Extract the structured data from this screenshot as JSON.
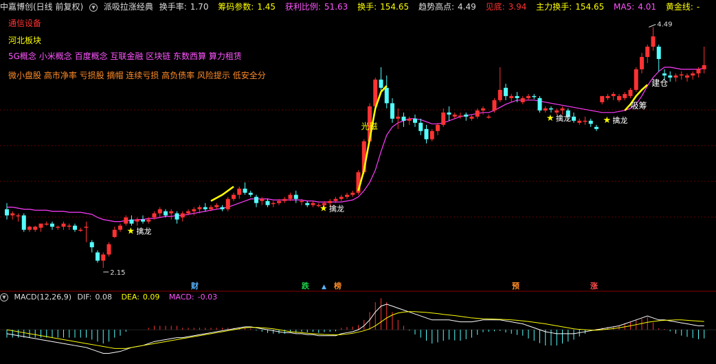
{
  "header": {
    "stock_name": "中嘉博创(日线 前复权)",
    "indicator_name": "派吸拉涨经典",
    "turnover_rate_label": "换手率:",
    "turnover_rate_value": "1.70",
    "chip_param_label": "筹码参数:",
    "chip_param_value": "1.45",
    "profit_ratio_label": "获利比例:",
    "profit_ratio_value": "51.63",
    "turnover_label": "换手:",
    "turnover_value": "154.65",
    "trend_high_label": "趋势高点:",
    "trend_high_value": "4.49",
    "bottom_label": "见底:",
    "bottom_value": "3.94",
    "main_turnover_label": "主力换手:",
    "main_turnover_value": "154.65",
    "ma5_label": "MA5:",
    "ma5_value": "4.01",
    "golden_line_label": "黄金线:",
    "golden_line_value": "-"
  },
  "tags": {
    "industry": "通信设备",
    "region": "河北板块",
    "concepts": "5G概念 小米概念 百度概念 互联金融 区块链 东数西算 算力租赁",
    "styles": "微小盘股 高市净率 亏损股 摘帽 连续亏损 高负债率 风险提示 低安全分"
  },
  "price_annotations": {
    "high_label": "4.49",
    "low_label": "2.15",
    "star_glyph": "★",
    "signal_label": "擒龙",
    "absorb_label": "吸筹",
    "build_label": "建仓",
    "lights_label": "光磁"
  },
  "event_marks": [
    {
      "label": "财",
      "color": "#5ab4ff"
    },
    {
      "label": "跌",
      "color": "#1ed04a"
    },
    {
      "label": "榜",
      "color": "#ff8c28"
    },
    {
      "label": "预",
      "color": "#ff8c28"
    },
    {
      "label": "涨",
      "color": "#ff4a4a"
    }
  ],
  "macd": {
    "title": "MACD(12,26,9)",
    "dif_label": "DIF:",
    "dif_value": "0.08",
    "dea_label": "DEA:",
    "dea_value": "0.09",
    "macd_label": "MACD:",
    "macd_value": "-0.03"
  },
  "colors": {
    "background": "#000000",
    "up": "#ff3232",
    "down": "#54ffff",
    "ma_line": "#ff3cff",
    "signal_line": "#ffff00",
    "dif_line": "#ffffff",
    "dea_line": "#ffff00",
    "grid": "#8b0000",
    "label_cyan": "#00ffff",
    "label_yellow": "#ffff00",
    "label_magenta": "#ff55ff",
    "label_red": "#ff3232"
  },
  "chart_data": {
    "type": "candlestick",
    "price_ylim": [
      2.05,
      4.62
    ],
    "candles": [
      [
        2.72,
        2.78,
        2.66,
        2.62
      ],
      [
        2.66,
        2.7,
        2.68,
        2.62
      ],
      [
        2.66,
        2.68,
        2.66,
        2.6
      ],
      [
        2.66,
        2.68,
        2.52,
        2.5
      ],
      [
        2.52,
        2.56,
        2.55,
        2.5
      ],
      [
        2.52,
        2.56,
        2.55,
        2.5
      ],
      [
        2.54,
        2.58,
        2.58,
        2.5
      ],
      [
        2.58,
        2.6,
        2.58,
        2.56
      ],
      [
        2.58,
        2.6,
        2.55,
        2.52
      ],
      [
        2.55,
        2.56,
        2.55,
        2.52
      ],
      [
        2.55,
        2.6,
        2.58,
        2.52
      ],
      [
        2.55,
        2.58,
        2.56,
        2.52
      ],
      [
        2.56,
        2.58,
        2.52,
        2.5
      ],
      [
        2.52,
        2.54,
        2.52,
        2.5
      ],
      [
        2.55,
        2.6,
        2.55,
        2.4
      ],
      [
        2.4,
        2.42,
        2.35,
        2.3
      ],
      [
        2.3,
        2.32,
        2.22,
        2.2
      ],
      [
        2.22,
        2.3,
        2.28,
        2.15
      ],
      [
        2.28,
        2.4,
        2.38,
        2.26
      ],
      [
        2.45,
        2.55,
        2.52,
        2.44
      ],
      [
        2.52,
        2.58,
        2.56,
        2.5
      ],
      [
        2.58,
        2.66,
        2.64,
        2.56
      ],
      [
        2.62,
        2.66,
        2.58,
        2.56
      ],
      [
        2.6,
        2.64,
        2.62,
        2.56
      ],
      [
        2.62,
        2.66,
        2.6,
        2.58
      ],
      [
        2.6,
        2.64,
        2.62,
        2.58
      ],
      [
        2.64,
        2.7,
        2.68,
        2.62
      ],
      [
        2.68,
        2.74,
        2.72,
        2.64
      ],
      [
        2.7,
        2.72,
        2.66,
        2.64
      ],
      [
        2.68,
        2.72,
        2.7,
        2.62
      ],
      [
        2.68,
        2.7,
        2.62,
        2.58
      ],
      [
        2.64,
        2.7,
        2.68,
        2.6
      ],
      [
        2.68,
        2.72,
        2.7,
        2.66
      ],
      [
        2.7,
        2.74,
        2.72,
        2.66
      ],
      [
        2.72,
        2.76,
        2.74,
        2.68
      ],
      [
        2.74,
        2.78,
        2.72,
        2.7
      ],
      [
        2.72,
        2.76,
        2.74,
        2.7
      ],
      [
        2.74,
        2.78,
        2.76,
        2.72
      ],
      [
        2.74,
        2.76,
        2.72,
        2.7
      ],
      [
        2.72,
        2.84,
        2.82,
        2.7
      ],
      [
        2.82,
        2.88,
        2.86,
        2.8
      ],
      [
        2.86,
        2.94,
        2.92,
        2.82
      ],
      [
        2.92,
        2.98,
        2.88,
        2.86
      ],
      [
        2.88,
        2.9,
        2.86,
        2.84
      ],
      [
        2.84,
        2.86,
        2.78,
        2.74
      ],
      [
        2.8,
        2.84,
        2.82,
        2.76
      ],
      [
        2.8,
        2.82,
        2.76,
        2.74
      ],
      [
        2.78,
        2.8,
        2.78,
        2.74
      ],
      [
        2.78,
        2.82,
        2.8,
        2.76
      ],
      [
        2.8,
        2.84,
        2.82,
        2.78
      ],
      [
        2.82,
        2.88,
        2.86,
        2.8
      ],
      [
        2.86,
        2.9,
        2.82,
        2.78
      ],
      [
        2.8,
        2.82,
        2.8,
        2.76
      ],
      [
        2.78,
        2.8,
        2.76,
        2.74
      ],
      [
        2.76,
        2.8,
        2.78,
        2.74
      ],
      [
        2.76,
        2.78,
        2.76,
        2.74
      ],
      [
        2.76,
        2.8,
        2.78,
        2.74
      ],
      [
        2.78,
        2.82,
        2.8,
        2.74
      ],
      [
        2.8,
        2.84,
        2.82,
        2.78
      ],
      [
        2.82,
        2.86,
        2.84,
        2.8
      ],
      [
        2.84,
        2.88,
        2.86,
        2.82
      ],
      [
        2.86,
        2.9,
        2.88,
        2.84
      ],
      [
        2.88,
        3.1,
        3.08,
        2.86
      ],
      [
        3.08,
        3.4,
        3.38,
        3.06
      ],
      [
        3.38,
        3.75,
        3.72,
        3.36
      ],
      [
        3.72,
        4.0,
        3.98,
        3.7
      ],
      [
        3.98,
        4.1,
        3.9,
        3.84
      ],
      [
        3.9,
        4.02,
        3.75,
        3.7
      ],
      [
        3.75,
        3.8,
        3.6,
        3.56
      ],
      [
        3.6,
        3.7,
        3.62,
        3.5
      ],
      [
        3.62,
        3.66,
        3.58,
        3.52
      ],
      [
        3.58,
        3.62,
        3.6,
        3.54
      ],
      [
        3.6,
        3.64,
        3.56,
        3.52
      ],
      [
        3.56,
        3.6,
        3.48,
        3.44
      ],
      [
        3.5,
        3.54,
        3.4,
        3.36
      ],
      [
        3.4,
        3.5,
        3.48,
        3.38
      ],
      [
        3.48,
        3.56,
        3.54,
        3.44
      ],
      [
        3.54,
        3.7,
        3.66,
        3.52
      ],
      [
        3.66,
        3.72,
        3.64,
        3.58
      ],
      [
        3.62,
        3.66,
        3.64,
        3.6
      ],
      [
        3.62,
        3.66,
        3.63,
        3.6
      ],
      [
        3.64,
        3.66,
        3.62,
        3.58
      ],
      [
        3.6,
        3.64,
        3.62,
        3.58
      ],
      [
        3.62,
        3.7,
        3.68,
        3.6
      ],
      [
        3.68,
        3.72,
        3.7,
        3.64
      ],
      [
        3.62,
        3.64,
        3.62,
        3.6
      ],
      [
        3.68,
        3.8,
        3.78,
        3.66
      ],
      [
        3.78,
        4.1,
        3.88,
        3.76
      ],
      [
        3.9,
        3.94,
        3.82,
        3.78
      ],
      [
        3.8,
        3.84,
        3.82,
        3.76
      ],
      [
        3.82,
        3.86,
        3.8,
        3.76
      ],
      [
        3.76,
        3.82,
        3.8,
        3.74
      ],
      [
        3.8,
        3.84,
        3.82,
        3.78
      ],
      [
        3.82,
        3.84,
        3.81,
        3.79
      ],
      [
        3.8,
        3.82,
        3.68,
        3.66
      ],
      [
        3.68,
        3.72,
        3.7,
        3.66
      ],
      [
        3.7,
        3.72,
        3.69,
        3.66
      ],
      [
        3.66,
        3.7,
        3.68,
        3.64
      ],
      [
        3.68,
        3.72,
        3.7,
        3.64
      ],
      [
        3.68,
        3.7,
        3.62,
        3.6
      ],
      [
        3.62,
        3.66,
        3.58,
        3.56
      ],
      [
        3.56,
        3.6,
        3.58,
        3.54
      ],
      [
        3.58,
        3.62,
        3.58,
        3.54
      ],
      [
        3.58,
        3.6,
        3.55,
        3.52
      ],
      [
        3.52,
        3.54,
        3.5,
        3.48
      ],
      [
        3.76,
        3.8,
        3.82,
        3.74
      ],
      [
        3.8,
        3.84,
        3.82,
        3.78
      ],
      [
        3.82,
        3.86,
        3.84,
        3.78
      ],
      [
        3.78,
        3.84,
        3.82,
        3.76
      ],
      [
        3.8,
        3.86,
        3.84,
        3.78
      ],
      [
        3.82,
        3.9,
        3.88,
        3.8
      ],
      [
        3.88,
        4.1,
        4.08,
        3.86
      ],
      [
        4.08,
        4.24,
        4.2,
        4.04
      ],
      [
        4.2,
        4.32,
        4.3,
        4.14
      ],
      [
        4.3,
        4.49,
        4.4,
        4.26
      ],
      [
        4.3,
        4.32,
        4.18,
        4.06
      ],
      [
        4.04,
        4.08,
        4.02,
        3.98
      ],
      [
        4.02,
        4.06,
        4.0,
        3.96
      ],
      [
        4.0,
        4.04,
        4.02,
        3.96
      ],
      [
        4.02,
        4.06,
        4.03,
        3.98
      ],
      [
        4.0,
        4.04,
        4.02,
        3.96
      ],
      [
        4.02,
        4.06,
        4.04,
        3.98
      ],
      [
        4.04,
        4.1,
        4.08,
        4.0
      ],
      [
        4.08,
        4.3,
        4.12,
        4.04
      ]
    ],
    "ma_line": [
      2.74,
      2.74,
      2.73,
      2.72,
      2.72,
      2.71,
      2.71,
      2.71,
      2.7,
      2.7,
      2.7,
      2.69,
      2.69,
      2.69,
      2.68,
      2.67,
      2.64,
      2.62,
      2.61,
      2.6,
      2.6,
      2.61,
      2.61,
      2.62,
      2.62,
      2.63,
      2.63,
      2.64,
      2.65,
      2.65,
      2.66,
      2.66,
      2.67,
      2.68,
      2.69,
      2.7,
      2.71,
      2.72,
      2.73,
      2.74,
      2.76,
      2.78,
      2.8,
      2.82,
      2.82,
      2.82,
      2.82,
      2.81,
      2.81,
      2.81,
      2.81,
      2.81,
      2.81,
      2.8,
      2.8,
      2.79,
      2.79,
      2.79,
      2.79,
      2.79,
      2.8,
      2.81,
      2.84,
      2.9,
      2.98,
      3.1,
      3.28,
      3.44,
      3.52,
      3.56,
      3.58,
      3.6,
      3.6,
      3.59,
      3.57,
      3.55,
      3.55,
      3.56,
      3.58,
      3.6,
      3.62,
      3.63,
      3.64,
      3.65,
      3.66,
      3.66,
      3.68,
      3.71,
      3.74,
      3.76,
      3.78,
      3.78,
      3.78,
      3.78,
      3.77,
      3.76,
      3.75,
      3.74,
      3.73,
      3.72,
      3.71,
      3.7,
      3.69,
      3.68,
      3.67,
      3.66,
      3.66,
      3.66,
      3.67,
      3.68,
      3.7,
      3.74,
      3.82,
      3.92,
      4.0,
      4.06,
      4.1,
      4.1,
      4.09,
      4.08,
      4.08,
      4.08,
      4.08,
      4.09
    ],
    "signal_segments": [
      {
        "start": 36,
        "values": [
          2.8,
          2.83,
          2.86,
          2.9,
          2.94
        ]
      },
      {
        "start": 62,
        "values": [
          2.9,
          3.1,
          3.4,
          3.7,
          3.86,
          3.92
        ]
      },
      {
        "start": 109,
        "values": [
          3.68,
          3.74,
          3.82,
          3.88,
          3.93
        ]
      }
    ],
    "markers": [
      {
        "type": "star",
        "index": 22,
        "price": 2.56
      },
      {
        "type": "star",
        "index": 56,
        "price": 2.78
      },
      {
        "type": "star",
        "index": 96,
        "price": 3.66
      },
      {
        "type": "star",
        "index": 106,
        "price": 3.64
      },
      {
        "type": "label_high",
        "index": 113,
        "price": 4.49
      },
      {
        "type": "label_low",
        "index": 17,
        "price": 2.15
      }
    ],
    "macd_ylim": [
      -0.16,
      0.14
    ],
    "dif": [
      -0.02,
      -0.025,
      -0.03,
      -0.035,
      -0.04,
      -0.045,
      -0.05,
      -0.055,
      -0.06,
      -0.065,
      -0.07,
      -0.075,
      -0.08,
      -0.085,
      -0.09,
      -0.1,
      -0.11,
      -0.12,
      -0.12,
      -0.115,
      -0.11,
      -0.1,
      -0.09,
      -0.085,
      -0.08,
      -0.07,
      -0.06,
      -0.055,
      -0.05,
      -0.045,
      -0.04,
      -0.04,
      -0.035,
      -0.03,
      -0.025,
      -0.02,
      -0.015,
      -0.01,
      -0.005,
      0.0,
      0.005,
      0.01,
      0.015,
      0.015,
      0.01,
      0.005,
      0.0,
      -0.005,
      -0.01,
      -0.015,
      -0.015,
      -0.02,
      -0.02,
      -0.025,
      -0.025,
      -0.03,
      -0.03,
      -0.03,
      -0.03,
      -0.02,
      -0.015,
      -0.01,
      0.0,
      0.02,
      0.05,
      0.09,
      0.12,
      0.13,
      0.12,
      0.11,
      0.1,
      0.09,
      0.08,
      0.07,
      0.06,
      0.05,
      0.05,
      0.05,
      0.05,
      0.045,
      0.04,
      0.04,
      0.04,
      0.045,
      0.05,
      0.05,
      0.05,
      0.05,
      0.045,
      0.04,
      0.035,
      0.03,
      0.02,
      0.01,
      0.0,
      -0.01,
      -0.015,
      -0.02,
      -0.02,
      -0.02,
      -0.02,
      -0.015,
      -0.01,
      -0.005,
      0.0,
      0.005,
      0.01,
      0.015,
      0.02,
      0.03,
      0.04,
      0.05,
      0.06,
      0.07,
      0.06,
      0.05,
      0.05,
      0.045,
      0.04,
      0.035,
      0.03,
      0.025,
      0.02,
      0.02
    ],
    "dea": [
      0.0,
      -0.005,
      -0.01,
      -0.015,
      -0.02,
      -0.025,
      -0.03,
      -0.035,
      -0.04,
      -0.045,
      -0.05,
      -0.055,
      -0.06,
      -0.065,
      -0.07,
      -0.075,
      -0.08,
      -0.085,
      -0.09,
      -0.095,
      -0.095,
      -0.095,
      -0.09,
      -0.085,
      -0.08,
      -0.075,
      -0.07,
      -0.065,
      -0.06,
      -0.055,
      -0.05,
      -0.045,
      -0.04,
      -0.035,
      -0.03,
      -0.025,
      -0.02,
      -0.015,
      -0.01,
      -0.005,
      0.0,
      0.005,
      0.01,
      0.012,
      0.012,
      0.01,
      0.008,
      0.005,
      0.0,
      -0.005,
      -0.01,
      -0.012,
      -0.015,
      -0.018,
      -0.02,
      -0.022,
      -0.024,
      -0.025,
      -0.026,
      -0.025,
      -0.022,
      -0.018,
      -0.012,
      -0.005,
      0.005,
      0.02,
      0.04,
      0.06,
      0.075,
      0.085,
      0.09,
      0.092,
      0.092,
      0.09,
      0.088,
      0.085,
      0.082,
      0.078,
      0.075,
      0.072,
      0.068,
      0.064,
      0.06,
      0.058,
      0.056,
      0.055,
      0.054,
      0.053,
      0.052,
      0.05,
      0.048,
      0.045,
      0.042,
      0.038,
      0.034,
      0.03,
      0.025,
      0.02,
      0.015,
      0.01,
      0.005,
      0.002,
      0.0,
      -0.002,
      -0.002,
      0.0,
      0.003,
      0.006,
      0.01,
      0.015,
      0.02,
      0.026,
      0.032,
      0.038,
      0.042,
      0.046,
      0.048,
      0.049,
      0.05,
      0.05,
      0.048,
      0.046,
      0.044,
      0.042
    ]
  }
}
